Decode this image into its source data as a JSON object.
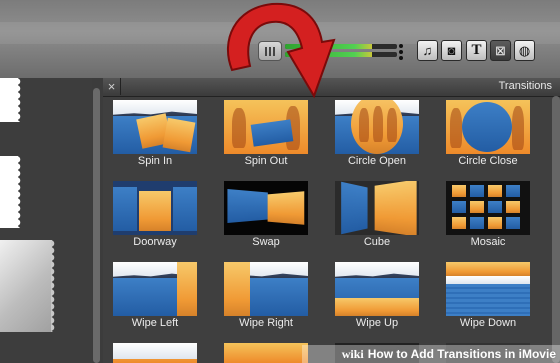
{
  "panel": {
    "title": "Transitions",
    "close_glyph": "×"
  },
  "toolbar": {
    "buttons": [
      {
        "icon": "music-note-icon",
        "glyph": "♫"
      },
      {
        "icon": "camera-icon",
        "glyph": "◙"
      },
      {
        "icon": "title-text-icon",
        "glyph": "T"
      },
      {
        "icon": "transitions-icon",
        "glyph": "⊠",
        "active": true
      },
      {
        "icon": "globe-map-icon",
        "glyph": "◍"
      }
    ],
    "volume_level": 0.78
  },
  "transitions": [
    {
      "label": "Spin In"
    },
    {
      "label": "Spin Out"
    },
    {
      "label": "Circle Open"
    },
    {
      "label": "Circle Close"
    },
    {
      "label": "Doorway"
    },
    {
      "label": "Swap"
    },
    {
      "label": "Cube"
    },
    {
      "label": "Mosaic"
    },
    {
      "label": "Wipe Left"
    },
    {
      "label": "Wipe Right"
    },
    {
      "label": "Wipe Up"
    },
    {
      "label": "Wipe Down"
    }
  ],
  "watermark": {
    "brand": "wiki",
    "text": "How to Add Transitions in iMovie"
  },
  "colors": {
    "annotation_arrow": "#d42020",
    "meter_green": "#3cbf3c"
  }
}
